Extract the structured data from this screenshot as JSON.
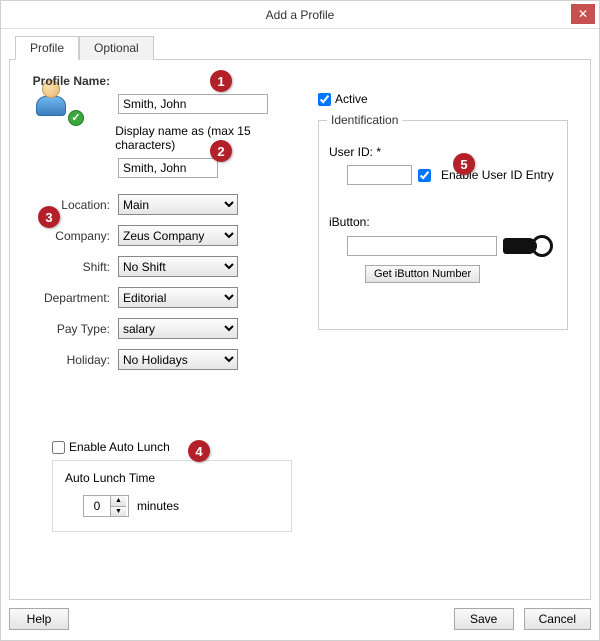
{
  "window": {
    "title": "Add a Profile",
    "close_glyph": "✕"
  },
  "tabs": {
    "profile": "Profile",
    "optional": "Optional"
  },
  "profile": {
    "name_label": "Profile Name:",
    "name_value": "Smith, John",
    "display_label": "Display name as (max 15 characters)",
    "display_value": "Smith, John",
    "location_label": "Location:",
    "location_value": "Main",
    "company_label": "Company:",
    "company_value": "Zeus Company",
    "shift_label": "Shift:",
    "shift_value": "No Shift",
    "department_label": "Department:",
    "department_value": "Editorial",
    "paytype_label": "Pay Type:",
    "paytype_value": "salary",
    "holiday_label": "Holiday:",
    "holiday_value": "No Holidays"
  },
  "active": {
    "label": "Active",
    "checked": true
  },
  "identification": {
    "legend": "Identification",
    "userid_label": "User ID: *",
    "userid_value": "",
    "enable_label": "Enable User ID Entry",
    "enable_checked": true,
    "ibutton_label": "iButton:",
    "ibutton_value": "",
    "getibutton_button": "Get iButton Number"
  },
  "autolunch": {
    "enable_label": "Enable Auto Lunch",
    "enable_checked": false,
    "time_label": "Auto Lunch Time",
    "minutes_value": "0",
    "minutes_unit": "minutes"
  },
  "buttons": {
    "help": "Help",
    "save": "Save",
    "cancel": "Cancel"
  },
  "markers": {
    "m1": "1",
    "m2": "2",
    "m3": "3",
    "m4": "4",
    "m5": "5"
  }
}
